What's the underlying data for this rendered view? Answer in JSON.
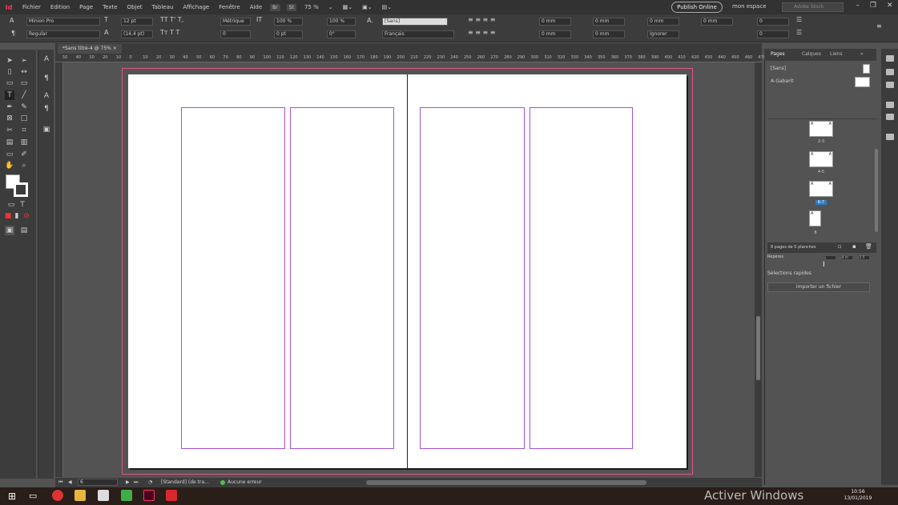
{
  "app": {
    "logo": "Id"
  },
  "menu": [
    "Fichier",
    "Edition",
    "Page",
    "Texte",
    "Objet",
    "Tableau",
    "Affichage",
    "Fenêtre",
    "Aide"
  ],
  "bridge": [
    "Br",
    "St"
  ],
  "zoom": "75 %",
  "publish_label": "Publish Online",
  "workspace_label": "mon espace",
  "search_placeholder": "Adobe Stock",
  "control": {
    "font": "Minion Pro",
    "style": "Regular",
    "size": "12 pt",
    "leading": "(14,4 pt)",
    "kerning": "Métrique",
    "tracking": "0",
    "hscale": "100 %",
    "vscale": "100 %",
    "baseline": "0 pt",
    "skew": "0°",
    "charstyle": "[Sans]",
    "language": "Français",
    "indent": [
      "0 mm",
      "0 mm",
      "0 mm",
      "0 mm",
      "0 mm",
      "0 mm"
    ],
    "ignore": "Ignorer",
    "counts": [
      "0",
      "0"
    ]
  },
  "document_tab": "*Sans titre-4 @ 75%",
  "ruler": [
    "50",
    "40",
    "30",
    "20",
    "10",
    "0",
    "10",
    "20",
    "30",
    "40",
    "50",
    "60",
    "70",
    "80",
    "90",
    "100",
    "110",
    "120",
    "130",
    "140",
    "150",
    "160",
    "170",
    "180",
    "190",
    "200",
    "210",
    "220",
    "230",
    "240",
    "250",
    "260",
    "270",
    "280",
    "290",
    "300",
    "310",
    "320",
    "330",
    "340",
    "350",
    "360",
    "370",
    "380",
    "390",
    "400",
    "410",
    "420",
    "430",
    "440",
    "450",
    "460",
    "470"
  ],
  "status": {
    "page": "6",
    "style": "[Standard] (de tra...",
    "errors": "Aucune erreur"
  },
  "panel": {
    "tabs": [
      "Pages",
      "Calques",
      "Liens"
    ],
    "masters": [
      "[Sans]",
      "A-Gabarit"
    ],
    "spreads": [
      {
        "label": "2-3",
        "letters": [
          "A",
          "A"
        ]
      },
      {
        "label": "4-5",
        "letters": [
          "A",
          "A"
        ]
      },
      {
        "label": "6-7",
        "letters": [
          "A",
          "A"
        ]
      },
      {
        "label": "8",
        "letters": [
          "A"
        ]
      }
    ],
    "footer": "8 pages de 5 planches",
    "section": "Sélections rapides",
    "import_button": "Importer un fichier",
    "pieces_label": "Repères",
    "pieces_values": [
      "4 m",
      "1 5"
    ]
  },
  "taskbar": {
    "watermark": "Activer Windows",
    "time": "10:56",
    "date": "13/01/2019"
  },
  "colors": {
    "margin": "#a64fd8",
    "bleed": "#e0558d",
    "selected_spread": "#2d7cc1"
  }
}
